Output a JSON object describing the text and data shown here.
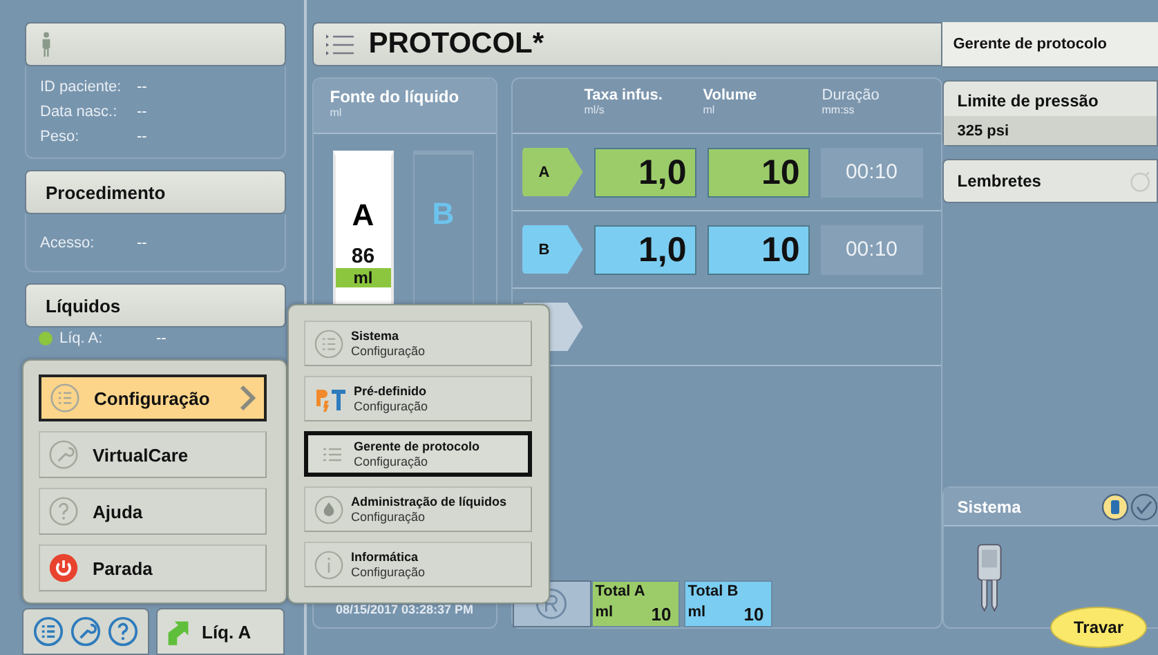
{
  "patient": {
    "fields": [
      {
        "label": "ID paciente:",
        "value": "--"
      },
      {
        "label": "Data nasc.:",
        "value": "--"
      },
      {
        "label": "Peso:",
        "value": "--"
      }
    ]
  },
  "procedure": {
    "title": "Procedimento",
    "fields": [
      {
        "label": "Acesso:",
        "value": "--"
      }
    ]
  },
  "fluids": {
    "title": "Líquidos",
    "items": [
      {
        "label": "Líq. A:",
        "value": "--",
        "color": "#8cc63f"
      }
    ]
  },
  "menu": {
    "items": [
      {
        "label": "Configuração",
        "kind": "list",
        "selected": true,
        "submenu": true
      },
      {
        "label": "VirtualCare",
        "kind": "wrench",
        "selected": false,
        "submenu": false
      },
      {
        "label": "Ajuda",
        "kind": "help",
        "selected": false,
        "submenu": false
      },
      {
        "label": "Parada",
        "kind": "power",
        "selected": false,
        "submenu": false
      }
    ]
  },
  "submenu": {
    "items": [
      {
        "title": "Sistema",
        "subtitle": "Configuração",
        "kind": "list",
        "selected": false
      },
      {
        "title": "Pré-definido",
        "subtitle": "Configuração",
        "kind": "p3t",
        "selected": false
      },
      {
        "title": "Gerente de protocolo",
        "subtitle": "Configuração",
        "kind": "lines",
        "selected": true
      },
      {
        "title": "Administração de líquidos",
        "subtitle": "Configuração",
        "kind": "drop",
        "selected": false
      },
      {
        "title": "Informática",
        "subtitle": "Configuração",
        "kind": "info",
        "selected": false
      }
    ]
  },
  "bottom_bar": {
    "fluid_button": "Líq. A"
  },
  "protocol": {
    "title": "PROTOCOL*",
    "source": {
      "title": "Fonte do líquido",
      "unit": "ml",
      "syringes": [
        {
          "label": "A",
          "volume": "86",
          "unit": "ml",
          "color": "#8cc63f",
          "filled": true
        },
        {
          "label": "B",
          "color": "#6cc4ee",
          "filled": false
        }
      ]
    },
    "datetime": "08/15/2017 03:28:37 PM",
    "columns": [
      {
        "label": "Taxa infus.",
        "unit": "ml/s",
        "disabled": false
      },
      {
        "label": "Volume",
        "unit": "ml",
        "disabled": false
      },
      {
        "label": "Duração",
        "unit": "mm:ss",
        "disabled": true
      }
    ],
    "rows": [
      {
        "kind": "phase",
        "phase": "A",
        "rate": "1,0",
        "volume": "10",
        "duration": "00:10",
        "color": "#9ccc6a"
      },
      {
        "kind": "phase",
        "phase": "B",
        "rate": "1,0",
        "volume": "10",
        "duration": "00:10",
        "color": "#7ccdf2"
      },
      {
        "kind": "empty"
      }
    ],
    "totals": [
      {
        "label": "Total A",
        "unit": "ml",
        "value": "10",
        "color": "#9ccc6a"
      },
      {
        "label": "Total B",
        "unit": "ml",
        "value": "10",
        "color": "#7ccdf2"
      }
    ]
  },
  "right": {
    "header": "Gerente de protocolo",
    "pressure": {
      "label": "Limite de pressão",
      "value": "325 psi"
    },
    "reminders": {
      "label": "Lembretes"
    },
    "system": {
      "title": "Sistema"
    },
    "lock_button": "Travar"
  }
}
